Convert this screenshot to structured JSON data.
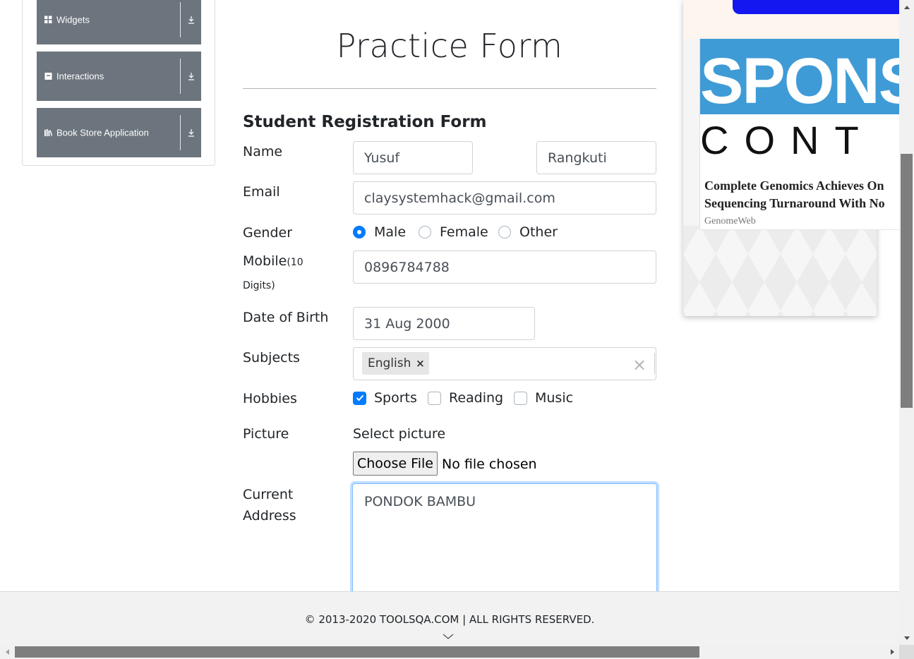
{
  "sidebar": {
    "items": [
      {
        "label": "Widgets",
        "icon": "grid-icon"
      },
      {
        "label": "Interactions",
        "icon": "box-icon"
      },
      {
        "label": "Book Store Application",
        "icon": "books-icon"
      }
    ]
  },
  "page": {
    "title": "Practice Form",
    "form_heading": "Student Registration Form"
  },
  "form": {
    "name_label": "Name",
    "first_name": "Yusuf",
    "last_name": "Rangkuti",
    "email_label": "Email",
    "email": "claysystemhack@gmail.com",
    "gender_label": "Gender",
    "gender_options": [
      {
        "label": "Male",
        "selected": true
      },
      {
        "label": "Female",
        "selected": false
      },
      {
        "label": "Other",
        "selected": false
      }
    ],
    "mobile_label": "Mobile",
    "mobile_hint": "(10",
    "mobile_hint2": "Digits)",
    "mobile": "0896784788",
    "dob_label": "Date of Birth",
    "dob": "31 Aug 2000",
    "subjects_label": "Subjects",
    "subjects": [
      "English"
    ],
    "subject_remove": "×",
    "subjects_clear": "×",
    "hobbies_label": "Hobbies",
    "hobbies": [
      {
        "label": "Sports",
        "checked": true
      },
      {
        "label": "Reading",
        "checked": false
      },
      {
        "label": "Music",
        "checked": false
      }
    ],
    "picture_label": "Picture",
    "picture_prompt": "Select picture",
    "choose_file_label": "Choose File",
    "file_status": "No file chosen",
    "address_label_1": "Current",
    "address_label_2": "Address",
    "address": "PONDOK BAMBU"
  },
  "ad": {
    "sponsored_text": "SPONS",
    "content_text": "CONT",
    "headline_1": "Complete Genomics Achieves On",
    "headline_2": "Sequencing Turnaround With No",
    "source": "GenomeWeb"
  },
  "footer": {
    "text": "© 2013-2020 TOOLSQA.COM | ALL RIGHTS RESERVED."
  },
  "colors": {
    "sidebar_item_bg": "#6c757d",
    "accent": "#007bff",
    "ad_blue": "#3f9bd6"
  }
}
